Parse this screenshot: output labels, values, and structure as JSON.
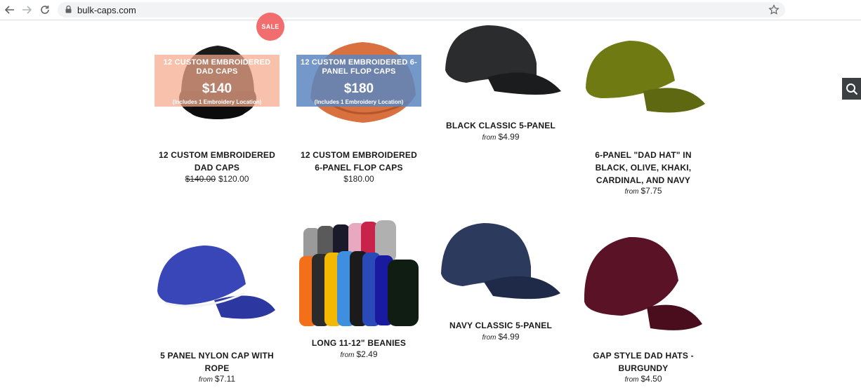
{
  "browser": {
    "url": "bulk-caps.com"
  },
  "sale_badge": "SALE",
  "products": [
    {
      "title": "12 CUSTOM EMBROIDERED DAD CAPS",
      "compare_price": "$140.00",
      "price": "$120.00",
      "promo": {
        "title": "12 CUSTOM EMBROIDERED DAD CAPS",
        "price": "$140",
        "note": "(Includes 1 Embroidery Location)"
      }
    },
    {
      "title": "12 CUSTOM EMBROIDERED 6-PANEL FLOP CAPS",
      "price": "$180.00",
      "promo": {
        "title": "12 CUSTOM EMBROIDERED 6-PANEL FLOP CAPS",
        "price": "$180",
        "note": "(Includes 1 Embroidery Location)"
      }
    },
    {
      "title": "BLACK CLASSIC 5-PANEL",
      "from": "from",
      "price": "$4.99"
    },
    {
      "title": "6-PANEL \"DAD HAT\" IN BLACK, OLIVE, KHAKI, CARDINAL, AND NAVY",
      "from": "from",
      "price": "$7.75"
    },
    {
      "title": "5 PANEL NYLON CAP WITH ROPE",
      "from": "from",
      "price": "$7.11"
    },
    {
      "title": "LONG 11-12\" BEANIES",
      "from": "from",
      "price": "$2.49"
    },
    {
      "title": "NAVY CLASSIC 5-PANEL",
      "from": "from",
      "price": "$4.99"
    },
    {
      "title": "GAP STYLE DAD HATS - BURGUNDY",
      "from": "from",
      "price": "$4.50"
    }
  ],
  "colors": {
    "sale_badge": "#f26d6d",
    "promo_pink": "#f4a98c",
    "promo_blue": "#5a86c0",
    "search_tab": "#3b3f42"
  }
}
